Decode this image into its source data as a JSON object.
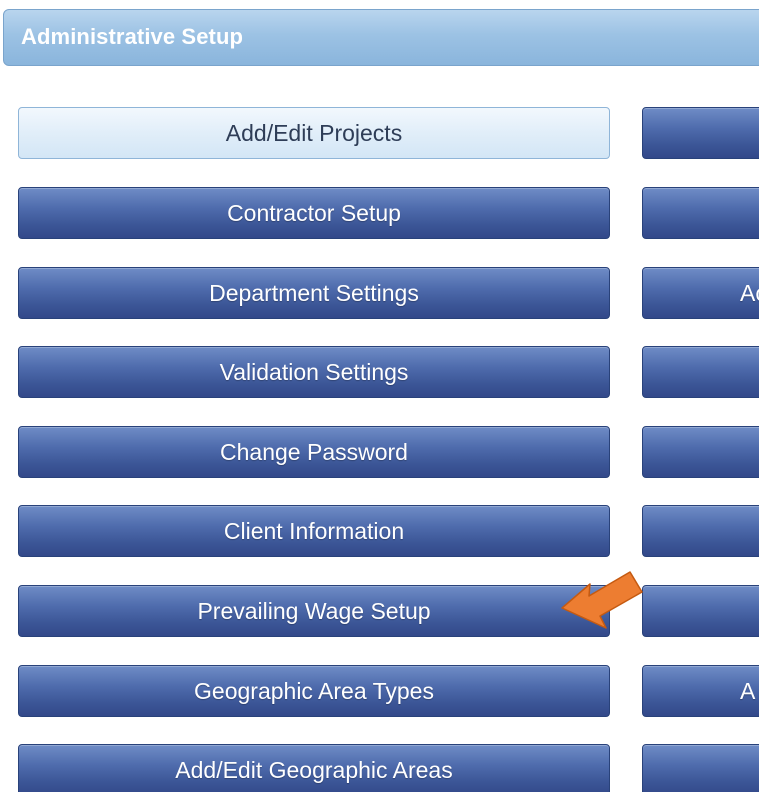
{
  "header": {
    "title": "Administrative Setup"
  },
  "left_buttons": [
    {
      "label": "Add/Edit Projects",
      "state": "active"
    },
    {
      "label": "Contractor Setup"
    },
    {
      "label": "Department Settings"
    },
    {
      "label": "Validation Settings"
    },
    {
      "label": "Change Password"
    },
    {
      "label": "Client Information"
    },
    {
      "label": "Prevailing Wage Setup"
    },
    {
      "label": "Geographic Area Types"
    },
    {
      "label": "Add/Edit Geographic Areas"
    }
  ],
  "right_buttons": [
    {
      "label": ""
    },
    {
      "label": ""
    },
    {
      "label": "Ac"
    },
    {
      "label": ""
    },
    {
      "label": ""
    },
    {
      "label": ""
    },
    {
      "label": ""
    },
    {
      "label": "A"
    },
    {
      "label": ""
    }
  ],
  "annotation": {
    "type": "orange-arrow-icon",
    "color": "#ed7d31",
    "points_to": "Prevailing Wage Setup"
  },
  "colors": {
    "header_bg": "#9cc2e4",
    "button_bg": "#4f6cad",
    "active_button_bg": "#e1eef9",
    "arrow": "#ed7d31"
  }
}
